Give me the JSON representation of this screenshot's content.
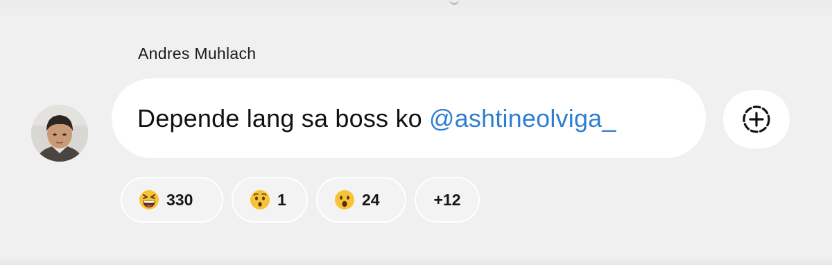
{
  "comment": {
    "author": "Andres Muhlach",
    "text": "Depende lang sa boss ko",
    "mention": "@ashtineolviga_"
  },
  "reactions": [
    {
      "icon": "grinning-squinting-face-icon",
      "count": "330"
    },
    {
      "icon": "hushed-face-icon",
      "count": "1"
    },
    {
      "icon": "face-with-open-mouth-icon",
      "count": "24"
    }
  ],
  "more_reactions": "+12",
  "colors": {
    "background": "#f0f0f0",
    "bubble": "#ffffff",
    "mention": "#2f7fd1",
    "emoji_yellow": "#f7c437"
  }
}
